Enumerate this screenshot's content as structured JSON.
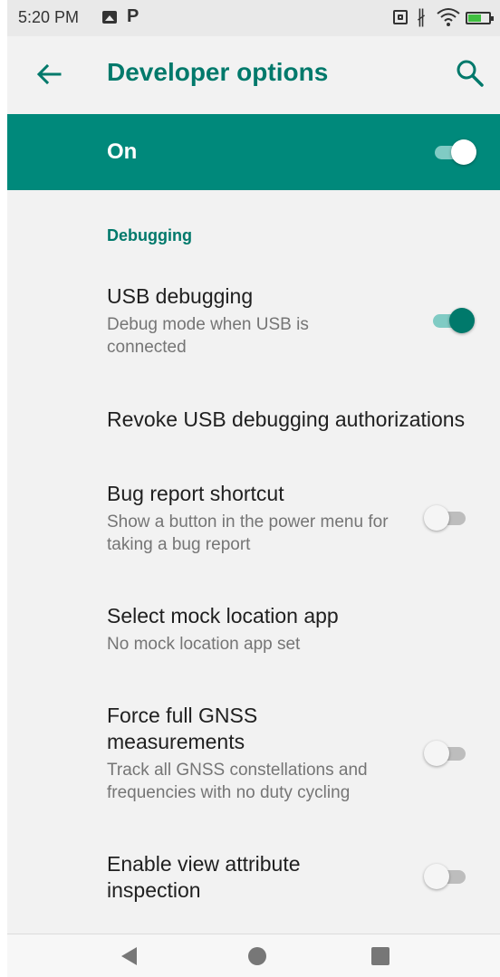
{
  "status_bar": {
    "time": "5:20 PM",
    "icons": [
      "gallery-icon",
      "p-icon",
      "nfc-icon",
      "bluetooth-icon",
      "wifi-icon",
      "battery-icon"
    ]
  },
  "app_bar": {
    "title": "Developer options",
    "back_icon": "arrow-left-icon",
    "search_icon": "search-icon"
  },
  "master_switch": {
    "label": "On",
    "state": true
  },
  "section": {
    "header": "Debugging"
  },
  "items": [
    {
      "title": "USB debugging",
      "subtitle": "Debug mode when USB is connected",
      "toggle": true
    },
    {
      "title": "Revoke USB debugging authorizations"
    },
    {
      "title": "Bug report shortcut",
      "subtitle": "Show a button in the power menu for taking a bug report",
      "toggle": false
    },
    {
      "title": "Select mock location app",
      "subtitle": "No mock location app set"
    },
    {
      "title": "Force full GNSS measurements",
      "subtitle": "Track all GNSS constellations and frequencies with no duty cycling",
      "toggle": false
    },
    {
      "title": "Enable view attribute inspection",
      "toggle": false
    }
  ],
  "colors": {
    "accent": "#00796b",
    "master_bar": "#00897b",
    "background": "#f2f2f2"
  }
}
